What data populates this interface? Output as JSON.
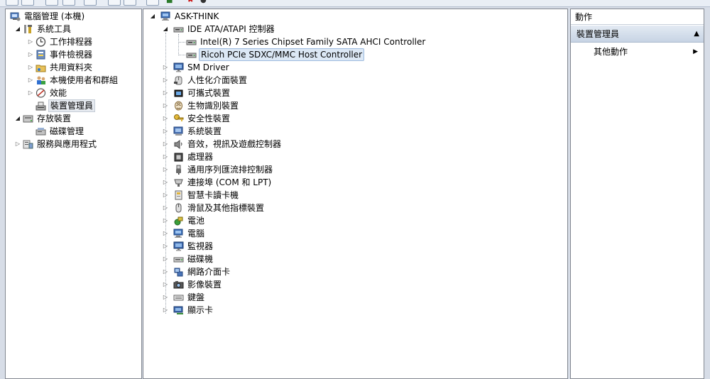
{
  "left_tree": [
    {
      "label": "電腦管理 (本機)",
      "icon": "computer-management-icon",
      "level": 0,
      "expander": ""
    },
    {
      "label": "系統工具",
      "icon": "tools-icon",
      "level": 1,
      "expander": "open"
    },
    {
      "label": "工作排程器",
      "icon": "clock-icon",
      "level": 2,
      "expander": "closed"
    },
    {
      "label": "事件檢視器",
      "icon": "event-viewer-icon",
      "level": 2,
      "expander": "closed"
    },
    {
      "label": "共用資料夾",
      "icon": "shared-folder-icon",
      "level": 2,
      "expander": "closed"
    },
    {
      "label": "本機使用者和群組",
      "icon": "users-icon",
      "level": 2,
      "expander": "closed"
    },
    {
      "label": "效能",
      "icon": "performance-icon",
      "level": 2,
      "expander": "closed"
    },
    {
      "label": "裝置管理員",
      "icon": "device-manager-icon",
      "level": 2,
      "expander": "",
      "selected": true
    },
    {
      "label": "存放裝置",
      "icon": "storage-icon",
      "level": 1,
      "expander": "open"
    },
    {
      "label": "磁碟管理",
      "icon": "disk-management-icon",
      "level": 2,
      "expander": ""
    },
    {
      "label": "服務與應用程式",
      "icon": "services-icon",
      "level": 1,
      "expander": "closed"
    }
  ],
  "device_tree": {
    "root": {
      "label": "ASK-THINK",
      "icon": "computer-icon"
    },
    "ide": {
      "label": "IDE ATA/ATAPI 控制器",
      "icon": "ide-controller-icon"
    },
    "ide_children": [
      {
        "label": "Intel(R) 7 Series Chipset Family SATA AHCI Controller",
        "icon": "ide-controller-icon"
      },
      {
        "label": "Ricoh PCIe SDXC/MMC Host Controller",
        "icon": "ide-controller-icon",
        "selected": true
      }
    ],
    "categories": [
      {
        "label": "SM Driver",
        "icon": "monitor-icon"
      },
      {
        "label": "人性化介面裝置",
        "icon": "hid-icon"
      },
      {
        "label": "可攜式裝置",
        "icon": "portable-device-icon"
      },
      {
        "label": "生物識別裝置",
        "icon": "fingerprint-icon"
      },
      {
        "label": "安全性裝置",
        "icon": "key-icon"
      },
      {
        "label": "系統裝置",
        "icon": "system-device-icon"
      },
      {
        "label": "音效，視訊及遊戲控制器",
        "icon": "speaker-icon"
      },
      {
        "label": "處理器",
        "icon": "processor-icon"
      },
      {
        "label": "通用序列匯流排控制器",
        "icon": "usb-icon"
      },
      {
        "label": "連接埠 (COM 和 LPT)",
        "icon": "port-icon"
      },
      {
        "label": "智慧卡讀卡機",
        "icon": "smart-card-reader-icon"
      },
      {
        "label": "滑鼠及其他指標裝置",
        "icon": "mouse-icon"
      },
      {
        "label": "電池",
        "icon": "battery-icon"
      },
      {
        "label": "電腦",
        "icon": "computer-icon"
      },
      {
        "label": "監視器",
        "icon": "monitor-icon"
      },
      {
        "label": "磁碟機",
        "icon": "disk-drive-icon"
      },
      {
        "label": "網路介面卡",
        "icon": "network-adapter-icon"
      },
      {
        "label": "影像裝置",
        "icon": "imaging-device-icon"
      },
      {
        "label": "鍵盤",
        "icon": "keyboard-icon"
      },
      {
        "label": "顯示卡",
        "icon": "display-adapter-icon"
      }
    ]
  },
  "actions": {
    "header": "動作",
    "section": "裝置管理員",
    "item": "其他動作"
  },
  "colors": {
    "selection_bg": "#dce8f5",
    "selection_border": "#9dbbdf",
    "pane_border": "#828790"
  }
}
